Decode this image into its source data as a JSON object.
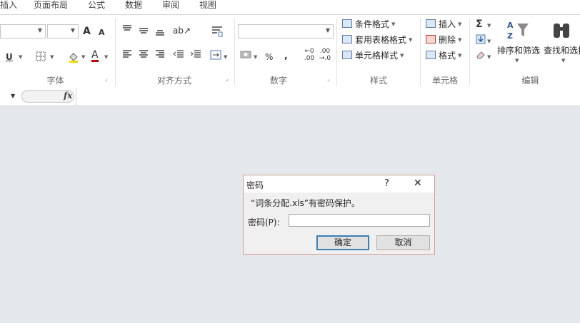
{
  "menubar": {
    "tabs": [
      "插入",
      "页面布局",
      "公式",
      "数据",
      "审阅",
      "视图"
    ]
  },
  "ribbon": {
    "groups": {
      "font": "字体",
      "alignment": "对齐方式",
      "number": "数字",
      "styles": "样式",
      "cells": "单元格",
      "editing": "编辑"
    },
    "styles": {
      "conditional": "条件格式",
      "table_format": "套用表格格式",
      "cell_styles": "单元格样式"
    },
    "cells": {
      "insert": "插入",
      "delete": "删除",
      "format": "格式"
    },
    "editing": {
      "sort_filter": "排序和筛选",
      "find_select": "查找和选择"
    },
    "number": {
      "percent": "%",
      "comma": ",",
      "inc_decimal_top": "←0",
      "inc_decimal_bot": ".00",
      "dec_decimal_top": ".00",
      "dec_decimal_bot": "→.0"
    },
    "font": {
      "grow": "A",
      "shrink": "A",
      "underline": "U",
      "font_color": "A"
    }
  },
  "formula_bar": {
    "fx": "fx"
  },
  "dialog": {
    "title": "密码",
    "help": "?",
    "close": "✕",
    "message": "“词条分配.xls”有密码保护。",
    "label": "密码(P):",
    "password_value": "",
    "ok": "确定",
    "cancel": "取消"
  }
}
